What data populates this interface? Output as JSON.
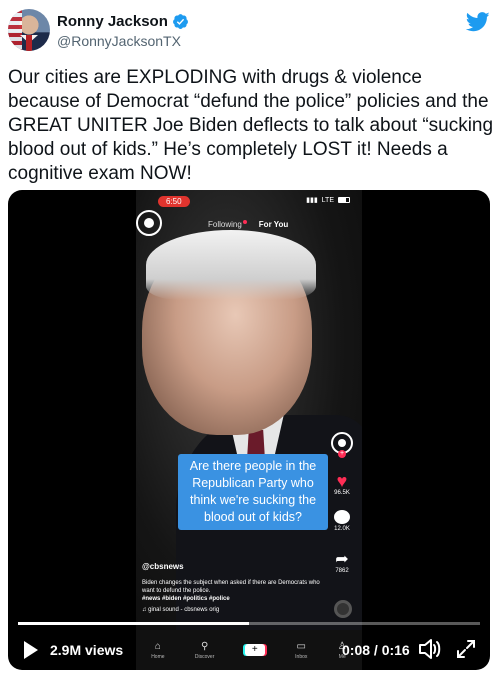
{
  "author": {
    "display_name": "Ronny Jackson",
    "handle": "@RonnyJacksonTX",
    "verified_icon": "verified-badge-icon"
  },
  "brand": {
    "icon": "twitter-bird-icon",
    "color": "#1d9bf0"
  },
  "tweet": {
    "text": "Our cities are EXPLODING with drugs & violence because of Democrat  “defund the police” policies and the GREAT UNITER Joe Biden deflects to talk about “sucking blood out of kids.” He’s completely LOST it! Needs a cognitive exam NOW!"
  },
  "embedded_phone": {
    "status_time": "6:50",
    "status_network": "LTE",
    "tabs": {
      "following": "Following",
      "for_you": "For You"
    },
    "caption": "Are there people in the Republican Party who think we're sucking the blood out of kids?",
    "likes": "96.5K",
    "comments": "12.0K",
    "shares": "7862",
    "username": "@cbsnews",
    "description": "Biden changes the subject when asked if there are Democrats who want to defund the police.",
    "hashtags": "#news #biden #politics #police",
    "sound": "♫  ginal sound - cbsnews   orig",
    "nav": {
      "home": "Home",
      "discover": "Discover",
      "inbox": "Inbox",
      "me": "Me",
      "add": "+"
    },
    "caption_color": "#3a92e2",
    "like_color": "#ff2d55"
  },
  "player": {
    "views": "2.9M views",
    "time": "0:08 / 0:16",
    "progress": 0.5
  }
}
